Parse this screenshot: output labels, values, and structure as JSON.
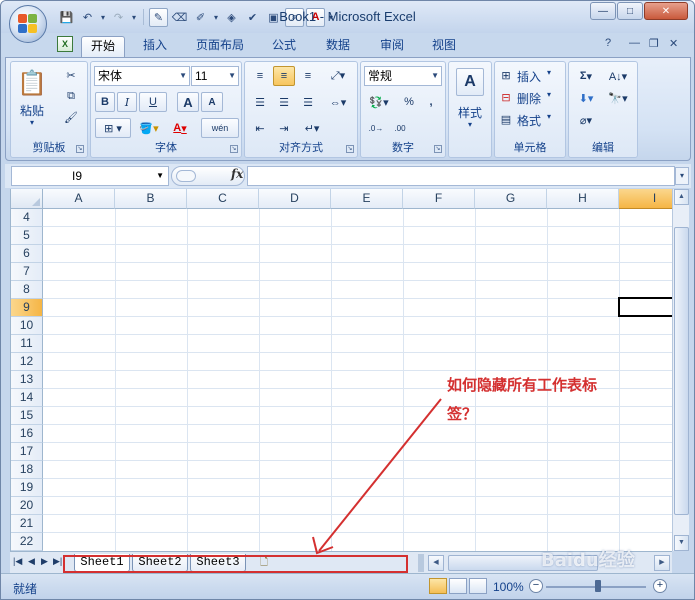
{
  "window": {
    "title": "Book1 - Microsoft Excel",
    "minimize_glyph": "—",
    "maximize_glyph": "□",
    "close_glyph": "✕"
  },
  "quick_access": {
    "icons": [
      "save-icon",
      "undo-icon",
      "redo-icon",
      "pen-icon",
      "eraser-icon",
      "draw-icon",
      "shapes-icon",
      "check-icon",
      "paste-special-icon",
      "find-icon",
      "font-color-icon",
      "customize-icon"
    ]
  },
  "tabs": [
    "开始",
    "插入",
    "页面布局",
    "公式",
    "数据",
    "审阅",
    "视图"
  ],
  "active_tab": "开始",
  "ribbon": {
    "clipboard": {
      "label": "剪贴板",
      "paste": "粘贴"
    },
    "font": {
      "label": "字体",
      "font_name": "宋体",
      "font_size": "11",
      "bold": "B",
      "italic": "I",
      "underline": "U",
      "grow": "A",
      "shrink": "A",
      "font_color_letter": "A",
      "phonetic": "wén"
    },
    "alignment": {
      "label": "对齐方式"
    },
    "number": {
      "label": "数字",
      "format": "常规",
      "percent": "%",
      "comma": ","
    },
    "styles": {
      "label": "样式"
    },
    "cells": {
      "label": "单元格",
      "insert": "插入",
      "delete": "删除",
      "format": "格式"
    },
    "editing": {
      "label": "编辑",
      "sum": "Σ"
    }
  },
  "formula_bar": {
    "name_box": "I9",
    "fx": "fx",
    "formula": ""
  },
  "grid": {
    "columns": [
      "A",
      "B",
      "C",
      "D",
      "E",
      "F",
      "G",
      "H",
      "I"
    ],
    "selected_column": "I",
    "rows": [
      "4",
      "5",
      "6",
      "7",
      "8",
      "9",
      "10",
      "11",
      "12",
      "13",
      "14",
      "15",
      "16",
      "17",
      "18",
      "19",
      "20",
      "21",
      "22"
    ],
    "selected_row": "9",
    "active_cell": "I9"
  },
  "sheets": [
    "Sheet1",
    "Sheet2",
    "Sheet3"
  ],
  "status": {
    "ready": "就绪",
    "zoom": "100%"
  },
  "annotation": {
    "text": "如何隐藏所有工作表标签？",
    "color": "#d43030"
  },
  "watermark": "Baidu经验"
}
